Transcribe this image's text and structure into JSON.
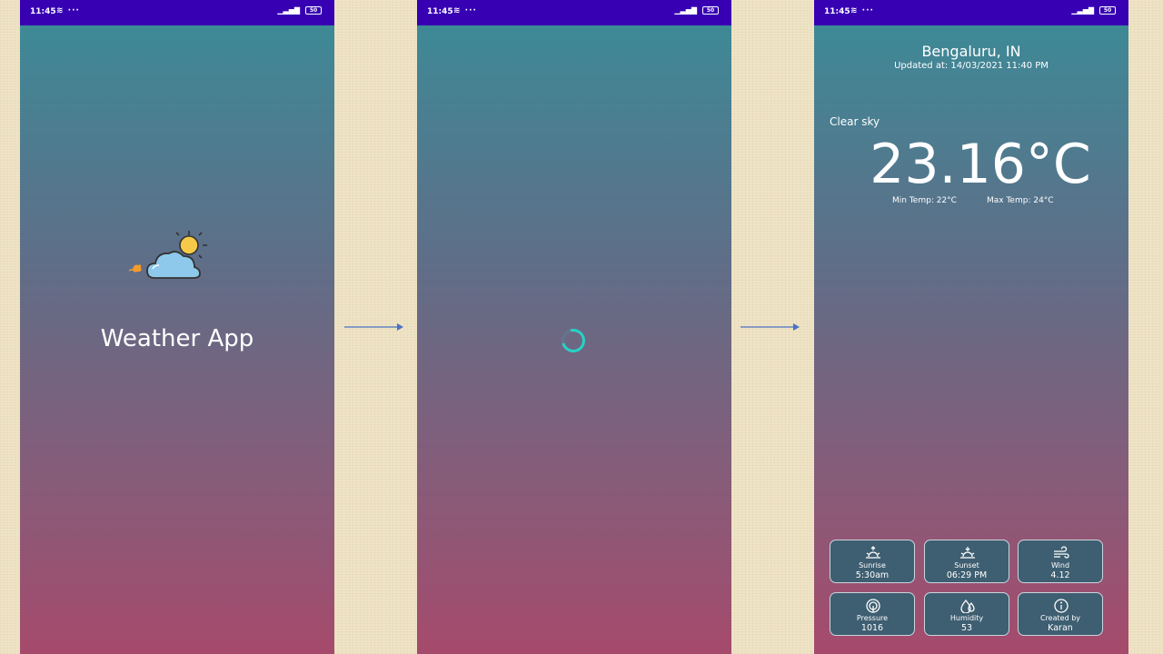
{
  "status_bar": {
    "time": "11:45",
    "battery": "50"
  },
  "splash": {
    "title": "Weather App"
  },
  "weather": {
    "location": "Bengaluru, IN",
    "updated": "Updated at: 14/03/2021 11:40 PM",
    "description": "Clear sky",
    "temperature": "23.16°C",
    "min_temp": "Min Temp: 22°C",
    "max_temp": "Max Temp: 24°C",
    "cards": [
      {
        "label": "Sunrise",
        "value": "5:30am",
        "icon": "sunrise-icon"
      },
      {
        "label": "Sunset",
        "value": "06:29 PM",
        "icon": "sunset-icon"
      },
      {
        "label": "Wind",
        "value": "4.12",
        "icon": "wind-icon"
      },
      {
        "label": "Pressure",
        "value": "1016",
        "icon": "pressure-icon"
      },
      {
        "label": "Humidity",
        "value": "53",
        "icon": "humidity-icon"
      },
      {
        "label": "Created by",
        "value": "Karan",
        "icon": "info-icon"
      }
    ]
  },
  "colors": {
    "status_bar": "#3700b3",
    "gradient_top": "#3a8c98",
    "gradient_bottom": "#a64a6c",
    "card_bg": "#3e5e71",
    "spinner": "#27d3c6"
  }
}
